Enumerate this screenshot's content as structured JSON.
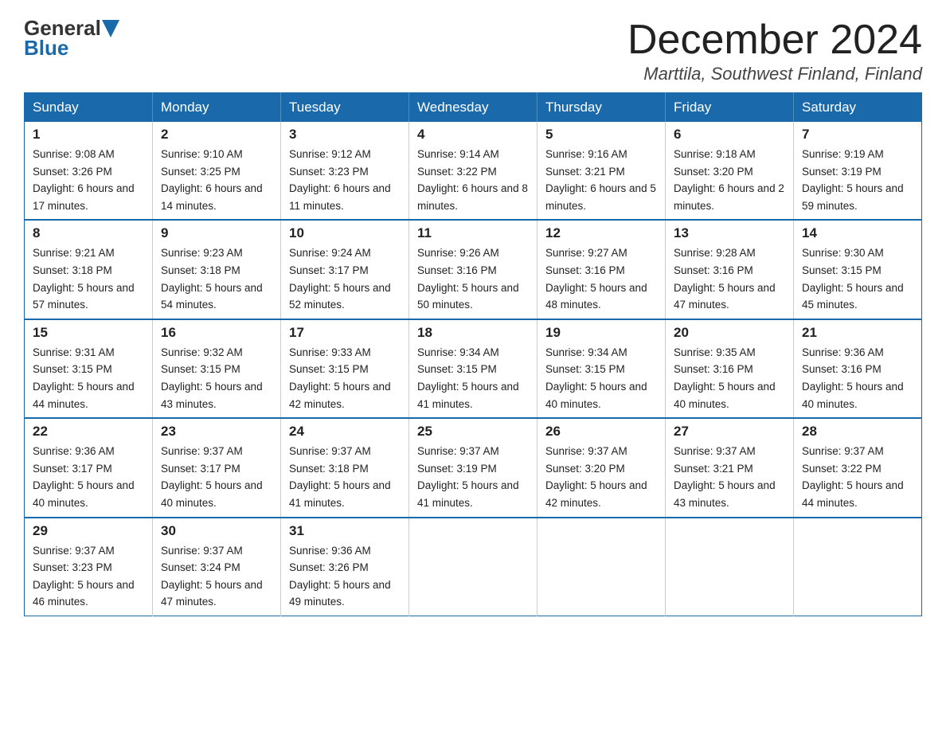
{
  "header": {
    "logo_general": "General",
    "logo_blue": "Blue",
    "month_title": "December 2024",
    "location": "Marttila, Southwest Finland, Finland"
  },
  "days_of_week": [
    "Sunday",
    "Monday",
    "Tuesday",
    "Wednesday",
    "Thursday",
    "Friday",
    "Saturday"
  ],
  "weeks": [
    [
      {
        "day": "1",
        "sunrise": "Sunrise: 9:08 AM",
        "sunset": "Sunset: 3:26 PM",
        "daylight": "Daylight: 6 hours and 17 minutes."
      },
      {
        "day": "2",
        "sunrise": "Sunrise: 9:10 AM",
        "sunset": "Sunset: 3:25 PM",
        "daylight": "Daylight: 6 hours and 14 minutes."
      },
      {
        "day": "3",
        "sunrise": "Sunrise: 9:12 AM",
        "sunset": "Sunset: 3:23 PM",
        "daylight": "Daylight: 6 hours and 11 minutes."
      },
      {
        "day": "4",
        "sunrise": "Sunrise: 9:14 AM",
        "sunset": "Sunset: 3:22 PM",
        "daylight": "Daylight: 6 hours and 8 minutes."
      },
      {
        "day": "5",
        "sunrise": "Sunrise: 9:16 AM",
        "sunset": "Sunset: 3:21 PM",
        "daylight": "Daylight: 6 hours and 5 minutes."
      },
      {
        "day": "6",
        "sunrise": "Sunrise: 9:18 AM",
        "sunset": "Sunset: 3:20 PM",
        "daylight": "Daylight: 6 hours and 2 minutes."
      },
      {
        "day": "7",
        "sunrise": "Sunrise: 9:19 AM",
        "sunset": "Sunset: 3:19 PM",
        "daylight": "Daylight: 5 hours and 59 minutes."
      }
    ],
    [
      {
        "day": "8",
        "sunrise": "Sunrise: 9:21 AM",
        "sunset": "Sunset: 3:18 PM",
        "daylight": "Daylight: 5 hours and 57 minutes."
      },
      {
        "day": "9",
        "sunrise": "Sunrise: 9:23 AM",
        "sunset": "Sunset: 3:18 PM",
        "daylight": "Daylight: 5 hours and 54 minutes."
      },
      {
        "day": "10",
        "sunrise": "Sunrise: 9:24 AM",
        "sunset": "Sunset: 3:17 PM",
        "daylight": "Daylight: 5 hours and 52 minutes."
      },
      {
        "day": "11",
        "sunrise": "Sunrise: 9:26 AM",
        "sunset": "Sunset: 3:16 PM",
        "daylight": "Daylight: 5 hours and 50 minutes."
      },
      {
        "day": "12",
        "sunrise": "Sunrise: 9:27 AM",
        "sunset": "Sunset: 3:16 PM",
        "daylight": "Daylight: 5 hours and 48 minutes."
      },
      {
        "day": "13",
        "sunrise": "Sunrise: 9:28 AM",
        "sunset": "Sunset: 3:16 PM",
        "daylight": "Daylight: 5 hours and 47 minutes."
      },
      {
        "day": "14",
        "sunrise": "Sunrise: 9:30 AM",
        "sunset": "Sunset: 3:15 PM",
        "daylight": "Daylight: 5 hours and 45 minutes."
      }
    ],
    [
      {
        "day": "15",
        "sunrise": "Sunrise: 9:31 AM",
        "sunset": "Sunset: 3:15 PM",
        "daylight": "Daylight: 5 hours and 44 minutes."
      },
      {
        "day": "16",
        "sunrise": "Sunrise: 9:32 AM",
        "sunset": "Sunset: 3:15 PM",
        "daylight": "Daylight: 5 hours and 43 minutes."
      },
      {
        "day": "17",
        "sunrise": "Sunrise: 9:33 AM",
        "sunset": "Sunset: 3:15 PM",
        "daylight": "Daylight: 5 hours and 42 minutes."
      },
      {
        "day": "18",
        "sunrise": "Sunrise: 9:34 AM",
        "sunset": "Sunset: 3:15 PM",
        "daylight": "Daylight: 5 hours and 41 minutes."
      },
      {
        "day": "19",
        "sunrise": "Sunrise: 9:34 AM",
        "sunset": "Sunset: 3:15 PM",
        "daylight": "Daylight: 5 hours and 40 minutes."
      },
      {
        "day": "20",
        "sunrise": "Sunrise: 9:35 AM",
        "sunset": "Sunset: 3:16 PM",
        "daylight": "Daylight: 5 hours and 40 minutes."
      },
      {
        "day": "21",
        "sunrise": "Sunrise: 9:36 AM",
        "sunset": "Sunset: 3:16 PM",
        "daylight": "Daylight: 5 hours and 40 minutes."
      }
    ],
    [
      {
        "day": "22",
        "sunrise": "Sunrise: 9:36 AM",
        "sunset": "Sunset: 3:17 PM",
        "daylight": "Daylight: 5 hours and 40 minutes."
      },
      {
        "day": "23",
        "sunrise": "Sunrise: 9:37 AM",
        "sunset": "Sunset: 3:17 PM",
        "daylight": "Daylight: 5 hours and 40 minutes."
      },
      {
        "day": "24",
        "sunrise": "Sunrise: 9:37 AM",
        "sunset": "Sunset: 3:18 PM",
        "daylight": "Daylight: 5 hours and 41 minutes."
      },
      {
        "day": "25",
        "sunrise": "Sunrise: 9:37 AM",
        "sunset": "Sunset: 3:19 PM",
        "daylight": "Daylight: 5 hours and 41 minutes."
      },
      {
        "day": "26",
        "sunrise": "Sunrise: 9:37 AM",
        "sunset": "Sunset: 3:20 PM",
        "daylight": "Daylight: 5 hours and 42 minutes."
      },
      {
        "day": "27",
        "sunrise": "Sunrise: 9:37 AM",
        "sunset": "Sunset: 3:21 PM",
        "daylight": "Daylight: 5 hours and 43 minutes."
      },
      {
        "day": "28",
        "sunrise": "Sunrise: 9:37 AM",
        "sunset": "Sunset: 3:22 PM",
        "daylight": "Daylight: 5 hours and 44 minutes."
      }
    ],
    [
      {
        "day": "29",
        "sunrise": "Sunrise: 9:37 AM",
        "sunset": "Sunset: 3:23 PM",
        "daylight": "Daylight: 5 hours and 46 minutes."
      },
      {
        "day": "30",
        "sunrise": "Sunrise: 9:37 AM",
        "sunset": "Sunset: 3:24 PM",
        "daylight": "Daylight: 5 hours and 47 minutes."
      },
      {
        "day": "31",
        "sunrise": "Sunrise: 9:36 AM",
        "sunset": "Sunset: 3:26 PM",
        "daylight": "Daylight: 5 hours and 49 minutes."
      },
      null,
      null,
      null,
      null
    ]
  ]
}
